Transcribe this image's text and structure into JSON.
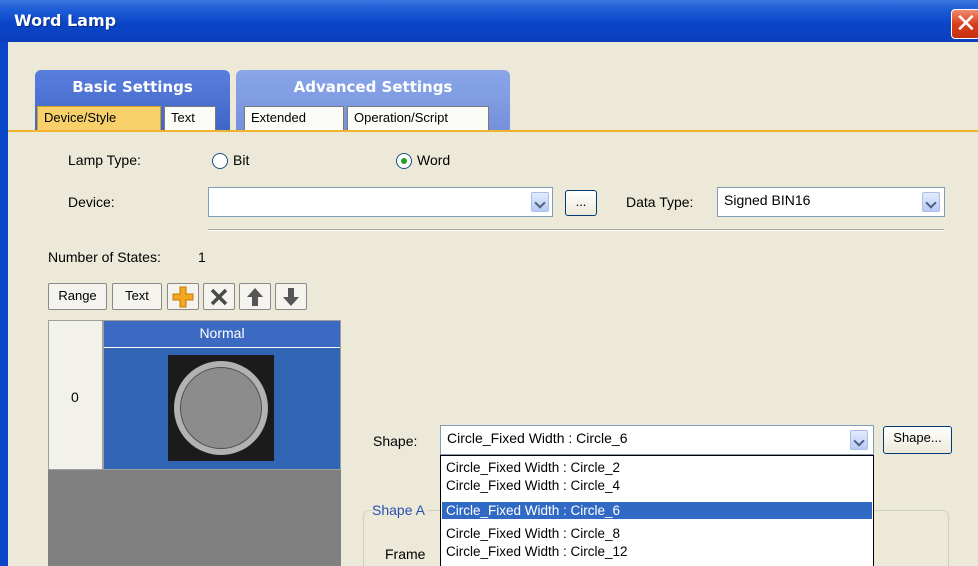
{
  "window": {
    "title": "Word Lamp",
    "close_glyph": "✕"
  },
  "tabs": {
    "basic": {
      "title": "Basic Settings",
      "subtabs": [
        "Device/Style",
        "Text"
      ],
      "active_subtab": "Device/Style"
    },
    "advanced": {
      "title": "Advanced Settings",
      "subtabs": [
        "Extended",
        "Operation/Script"
      ]
    }
  },
  "form": {
    "lamp_type_label": "Lamp Type:",
    "lamp_type_options": [
      "Bit",
      "Word"
    ],
    "lamp_type_selected": "Word",
    "device_label": "Device:",
    "device_value": "",
    "browse_label": "...",
    "data_type_label": "Data Type:",
    "data_type_value": "Signed BIN16"
  },
  "states": {
    "count_label": "Number of States:",
    "count": "1",
    "toolbar": {
      "range_label": "Range",
      "text_label": "Text"
    },
    "header": "Normal",
    "rows": [
      {
        "index": "0"
      }
    ]
  },
  "shape": {
    "label": "Shape:",
    "selected_value": "Circle_Fixed Width : Circle_6",
    "button_label": "Shape...",
    "options": [
      "Circle_Fixed Width : Circle_2",
      "Circle_Fixed Width : Circle_4",
      "Circle_Fixed Width : Circle_6",
      "Circle_Fixed Width : Circle_8",
      "Circle_Fixed Width : Circle_12"
    ],
    "highlighted_index": 2,
    "attr_group_label": "Shape A",
    "frame_label": "Frame"
  },
  "colors": {
    "title_bar": "#0a46c8",
    "active_tab": "#f7d06a",
    "selection": "#316ac5",
    "state_cell": "#3264b4"
  }
}
